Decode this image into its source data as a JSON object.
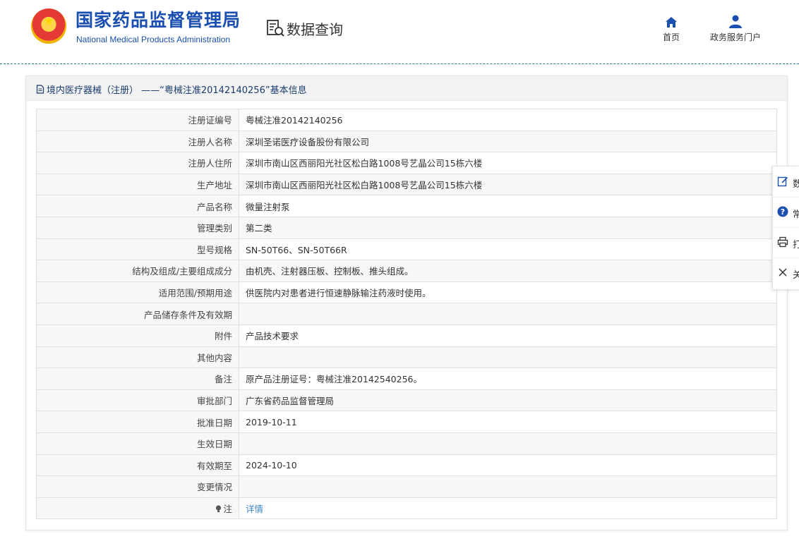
{
  "header": {
    "logo_cn": "国家药品监督管理局",
    "logo_en": "National Medical Products Administration",
    "section": "数据查询",
    "nav": [
      {
        "label": "首页",
        "icon": "home-icon"
      },
      {
        "label": "政务服务门户",
        "icon": "user-icon"
      }
    ]
  },
  "panel": {
    "title": "境内医疗器械（注册） ——“粤械注准20142140256”基本信息"
  },
  "rows": [
    {
      "key": "注册证编号",
      "value": "粤械注准20142140256"
    },
    {
      "key": "注册人名称",
      "value": "深圳圣诺医疗设备股份有限公司"
    },
    {
      "key": "注册人住所",
      "value": "深圳市南山区西丽阳光社区松白路1008号艺晶公司15栋六楼"
    },
    {
      "key": "生产地址",
      "value": "深圳市南山区西丽阳光社区松白路1008号艺晶公司15栋六楼"
    },
    {
      "key": "产品名称",
      "value": "微量注射泵"
    },
    {
      "key": "管理类别",
      "value": "第二类"
    },
    {
      "key": "型号规格",
      "value": "SN-50T66、SN-50T66R"
    },
    {
      "key": "结构及组成/主要组成成分",
      "value": "由机壳、注射器压板、控制板、推头组成。"
    },
    {
      "key": "适用范围/预期用途",
      "value": "供医院内对患者进行恒速静脉输注药液时使用。"
    },
    {
      "key": "产品储存条件及有效期",
      "value": ""
    },
    {
      "key": "附件",
      "value": "产品技术要求"
    },
    {
      "key": "其他内容",
      "value": ""
    },
    {
      "key": "备注",
      "value": "原产品注册证号：粤械注准20142540256。"
    },
    {
      "key": "审批部门",
      "value": "广东省药品监督管理局"
    },
    {
      "key": "批准日期",
      "value": "2019-10-11"
    },
    {
      "key": "生效日期",
      "value": ""
    },
    {
      "key": "有效期至",
      "value": "2024-10-10"
    },
    {
      "key": "变更情况",
      "value": ""
    }
  ],
  "note_row": {
    "key": "注",
    "link": "详情"
  },
  "side_toolbar": [
    {
      "label": "数",
      "icon": "edit-icon"
    },
    {
      "label": "常",
      "icon": "question-icon"
    },
    {
      "label": "打",
      "icon": "print-icon"
    },
    {
      "label": "关",
      "icon": "close-icon"
    }
  ],
  "colors": {
    "brand": "#1a4fb0",
    "link": "#3d84c8",
    "title": "#1a3c6e"
  }
}
